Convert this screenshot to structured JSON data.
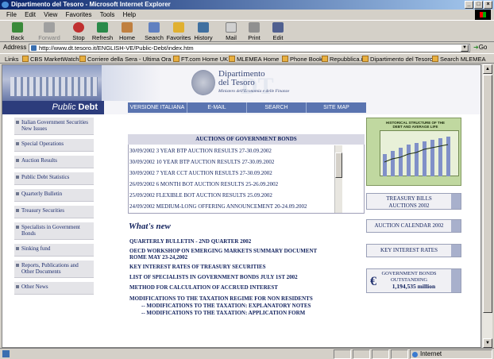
{
  "window": {
    "title": "Dipartimento del Tesoro - Microsoft Internet Explorer",
    "min": "_",
    "max": "□",
    "close": "×"
  },
  "menu": [
    "File",
    "Edit",
    "View",
    "Favorites",
    "Tools",
    "Help"
  ],
  "toolbar": {
    "back": "Back",
    "forward": "Forward",
    "stop": "Stop",
    "refresh": "Refresh",
    "home": "Home",
    "search": "Search",
    "favorites": "Favorites",
    "history": "History",
    "mail": "Mail",
    "print": "Print",
    "edit": "Edit"
  },
  "address": {
    "label": "Address",
    "url": "http://www.dt.tesoro.it/ENGLISH-VE/Public-Debt/index.htm",
    "go": "Go"
  },
  "links": {
    "label": "Links",
    "items": [
      "CBS MarketWatch",
      "Corriere della Sera - Ultima Ora",
      "FT.com Home UK",
      "MLEMEA Home",
      "Phone Book",
      "Repubblica.it",
      "Dipartimento del Tesoro",
      "Search MLEMEA"
    ]
  },
  "page": {
    "logo_line1": "Dipartimento",
    "logo_line2": "del Tesoro",
    "logo_sub": "Ministero dell'Economia e delle Finanze",
    "logo_watermark": "DT",
    "section_label_a": "Public ",
    "section_label_b": "Debt",
    "topnav": [
      "VERSIONE ITALIANA",
      "E-MAIL",
      "SEARCH",
      "SITE MAP"
    ],
    "sidebar": [
      "Italian Government Securities New Issues",
      "Special Operations",
      "Auction Results",
      "Public Debt Statistics",
      "Quarterly Bulletin",
      "Treasury Securities",
      "Specialists in Government Bonds",
      "Sinking fund",
      "Reports, Publications and Other Documents",
      "Other News"
    ],
    "auctions_title": "AUCTIONS OF GOVERNMENT BONDS",
    "auctions": [
      "30/09/2002 3 YEAR BTP AUCTION RESULTS 27-30.09.2002",
      "30/09/2002 10 YEAR BTP AUCTION RESULTS 27-30.09.2002",
      "30/09/2002 7 YEAR CCT AUCTION RESULTS 27-30.09.2002",
      "26/09/2002 6 MONTH BOT AUCTION RESULTS 25-26.09.2002",
      "25/09/2002 FLEXIBLE BOT AUCTION RESULTS 25.09.2002",
      "24/09/2002 MEDIUM-LONG OFFERING ANNOUNCEMENT 20-24.09.2002"
    ],
    "whats_new": "What's new",
    "news": [
      "QUARTERLY BULLETIN - 2ND QUARTER 2002",
      "OECD WORKSHOP ON EMERGING MARKETS SUMMARY DOCUMENT ROME MAY 23-24,2002",
      "KEY INTEREST RATES OF TREASURY SECURITIES",
      "LIST OF SPECIALISTS IN GOVERNMENT BONDS JULY 1ST 2002",
      "METHOD FOR CALCULATION OF ACCRUED INTEREST",
      "MODIFICATIONS TO THE TAXATION REGIME FOR NON RESIDENTS",
      "-- MODIFICATIONS TO THE TAXATION: EXPLANATORY NOTES",
      "-- MODIFICATIONS TO THE TAXATION: APPLICATION FORM"
    ],
    "chart_title": "HISTORICAL STRUCTURE OF THE DEBT AND AVERAGE LIFE",
    "right_boxes": {
      "bills_a": "TREASURY BILLS",
      "bills_b": "AUCTIONS 2002",
      "calendar": "AUCTION CALENDAR 2002",
      "rates": "KEY INTEREST RATES",
      "outstanding_a": "GOVERNMENT BONDS",
      "outstanding_b": "OUTSTANDING",
      "amount": "1,194,535",
      "unit": "million",
      "euro": "€"
    }
  },
  "status": {
    "zone": "Internet"
  },
  "colors": {
    "navy": "#2c3c7c",
    "nav": "#5a74b0",
    "text": "#10205c"
  }
}
